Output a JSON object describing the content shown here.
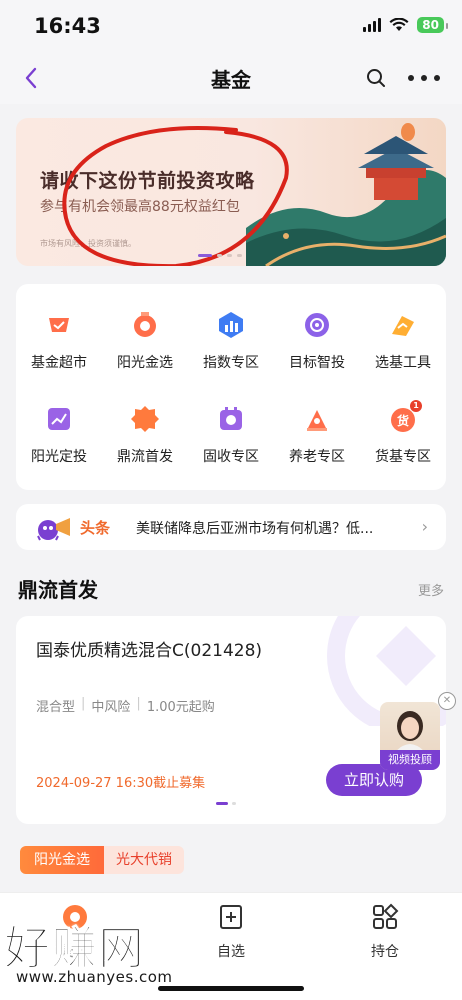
{
  "status": {
    "time": "16:43",
    "battery": "80"
  },
  "nav": {
    "title": "基金"
  },
  "banner": {
    "title": "请收下这份节前投资攻略",
    "subtitle": "参与有机会领最高88元权益红包",
    "note": "市场有风险，投资须谨慎。"
  },
  "grid": {
    "items": [
      {
        "label": "基金超市",
        "icon": "cart-icon",
        "color": "#ff6e4a"
      },
      {
        "label": "阳光金选",
        "icon": "medal-icon",
        "color": "#ff6e4a"
      },
      {
        "label": "指数专区",
        "icon": "chart-icon",
        "color": "#3f7cf3"
      },
      {
        "label": "目标智投",
        "icon": "target-icon",
        "color": "#8c62e8"
      },
      {
        "label": "选基工具",
        "icon": "tool-icon",
        "color": "#ffae33"
      },
      {
        "label": "阳光定投",
        "icon": "trend-icon",
        "color": "#9a63e6"
      },
      {
        "label": "鼎流首发",
        "icon": "new-icon",
        "color": "#ff7a3d",
        "badge": "NEW"
      },
      {
        "label": "固收专区",
        "icon": "coin-icon",
        "color": "#9a63e6"
      },
      {
        "label": "养老专区",
        "icon": "alarm-icon",
        "color": "#ff6e4a"
      },
      {
        "label": "货基专区",
        "icon": "money-icon",
        "color": "#ff6e4a",
        "badge": "1",
        "glyph": "货"
      }
    ]
  },
  "news": {
    "tag": "头条",
    "text": "美联储降息后亚洲市场有何机遇？低..."
  },
  "section": {
    "title": "鼎流首发",
    "more": "更多"
  },
  "product": {
    "name": "国泰优质精选混合C(021428)",
    "tags": [
      "混合型",
      "中风险",
      "1.00元起购"
    ],
    "deadline": "2024-09-27 16:30截止募集",
    "button": "立即认购"
  },
  "advisor": {
    "label": "视频投顾"
  },
  "tags": {
    "left": "阳光金选",
    "right": "光大代销"
  },
  "tabs": [
    {
      "label": "首页",
      "icon": "home-icon"
    },
    {
      "label": "自选",
      "icon": "bookmark-add-icon"
    },
    {
      "label": "持仓",
      "icon": "grid-icon"
    }
  ],
  "watermark": {
    "big": "好赚网",
    "small": "www.zhuanyes.com"
  }
}
